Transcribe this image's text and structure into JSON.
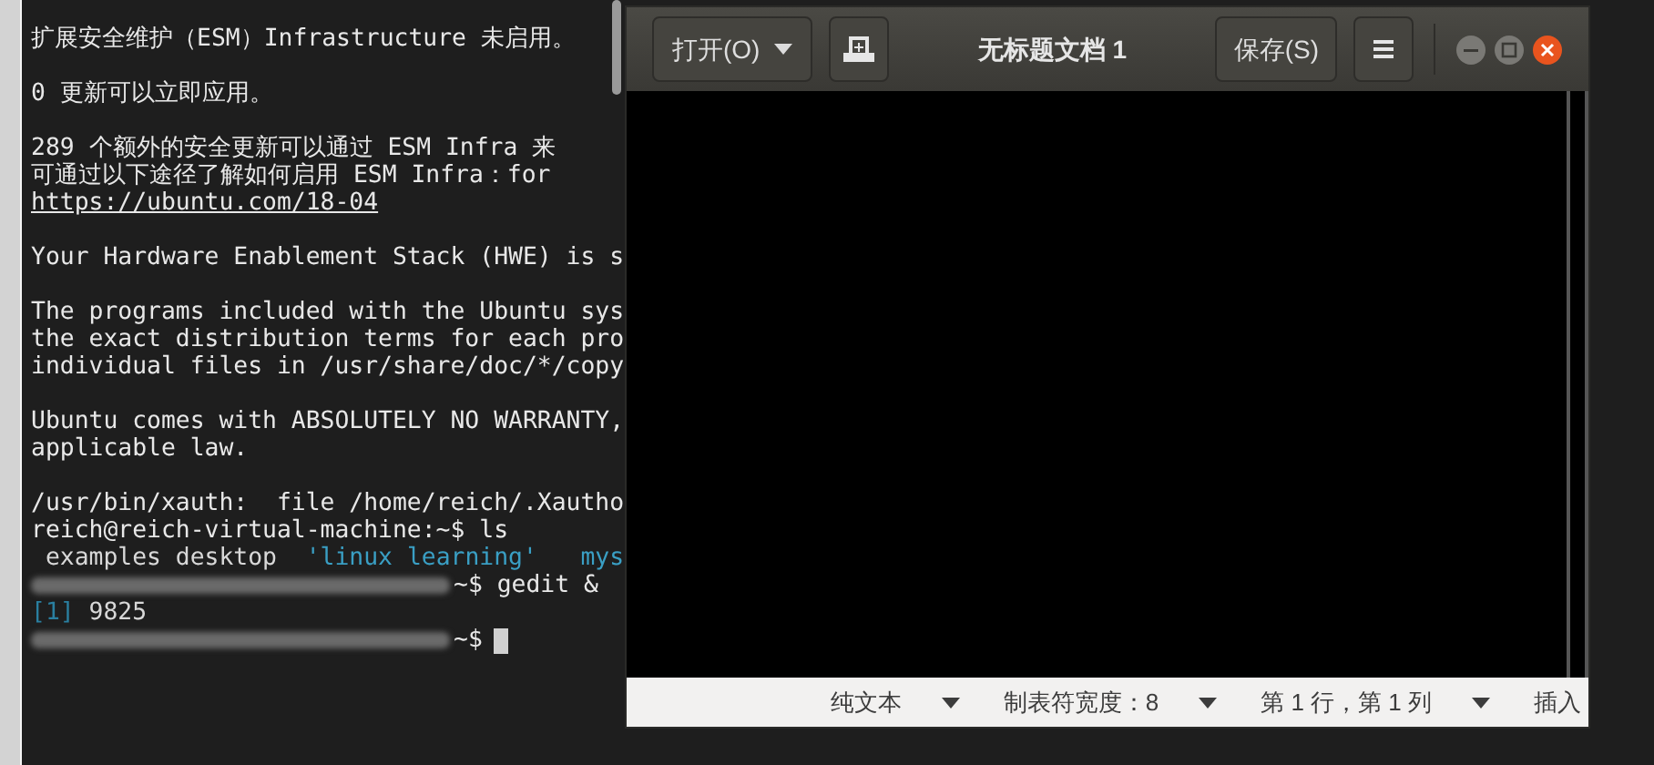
{
  "terminal": {
    "lines": [
      {
        "kind": "text",
        "text": "扩展安全维护（ESM）Infrastructure 未启用。"
      },
      {
        "kind": "blank"
      },
      {
        "kind": "text",
        "text": "0 更新可以立即应用。"
      },
      {
        "kind": "blank"
      },
      {
        "kind": "text",
        "text": "289 个额外的安全更新可以通过 ESM Infra 来"
      },
      {
        "kind": "text",
        "text": "可通过以下途径了解如何启用 ESM Infra：for"
      },
      {
        "kind": "link",
        "text": "https://ubuntu.com/18-04"
      },
      {
        "kind": "blank"
      },
      {
        "kind": "text",
        "text": "Your Hardware Enablement Stack (HWE) is s"
      },
      {
        "kind": "blank"
      },
      {
        "kind": "text",
        "text": "The programs included with the Ubuntu sys"
      },
      {
        "kind": "text",
        "text": "the exact distribution terms for each pro"
      },
      {
        "kind": "text",
        "text": "individual files in /usr/share/doc/*/copy"
      },
      {
        "kind": "blank"
      },
      {
        "kind": "text",
        "text": "Ubuntu comes with ABSOLUTELY NO WARRANTY,"
      },
      {
        "kind": "text",
        "text": "applicable law."
      },
      {
        "kind": "blank"
      },
      {
        "kind": "text",
        "text": "/usr/bin/xauth:  file /home/reich/.Xautho"
      },
      {
        "kind": "text",
        "text": "reich@reich-virtual-machine:~$ ls"
      },
      {
        "kind": "segments",
        "segments": [
          {
            "text": " examples desktop",
            "color": "#d8d8d8"
          },
          {
            "text": "  'linux learning'",
            "color": "#3a9fc4"
          },
          {
            "text": "   mys",
            "color": "#3a9fc4"
          }
        ]
      },
      {
        "kind": "blurred_prompt",
        "text": "~$ gedit &"
      },
      {
        "kind": "segments",
        "segments": [
          {
            "text": "[1]",
            "color": "#2a7fa0"
          },
          {
            "text": " 9825",
            "color": "#d8d8d8"
          }
        ]
      },
      {
        "kind": "blurred_prompt",
        "text": "~$",
        "cursor": true
      }
    ]
  },
  "gedit": {
    "open_button": "打开(O)",
    "title": "无标题文档 1",
    "save_button": "保存(S)",
    "status_bar": [
      {
        "label": "纯文本",
        "dropdown": true
      },
      {
        "label": "制表符宽度：8",
        "dropdown": true
      },
      {
        "label": "第 1 行，第 1 列",
        "dropdown": true
      },
      {
        "label": "插入",
        "dropdown": false
      }
    ]
  }
}
